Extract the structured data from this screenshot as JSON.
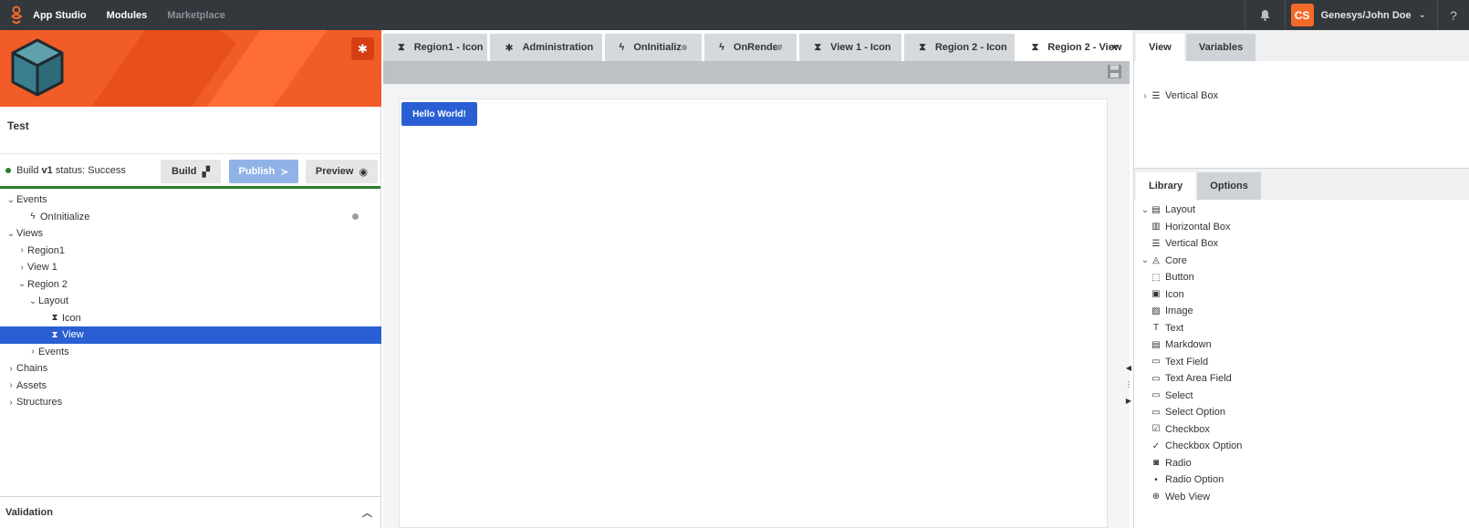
{
  "topbar": {
    "app_name": "App Studio",
    "modules": "Modules",
    "marketplace": "Marketplace",
    "avatar_initials": "CS",
    "user": "Genesys/John Doe",
    "help": "?"
  },
  "project": {
    "title": "Test",
    "build_prefix": "Build ",
    "build_version": "v1",
    "build_suffix": " status: Success",
    "build_btn": "Build",
    "publish_btn": "Publish",
    "preview_btn": "Preview"
  },
  "tree": [
    {
      "label": "Events",
      "level": 0,
      "arrow": "⌄",
      "icon": ""
    },
    {
      "label": "OnInitialize",
      "level": 1,
      "arrow": "",
      "icon": "ϟ",
      "dot": true
    },
    {
      "label": "Views",
      "level": 0,
      "arrow": "⌄",
      "icon": ""
    },
    {
      "label": "Region1",
      "level": 1,
      "arrow": "›",
      "icon": ""
    },
    {
      "label": "View 1",
      "level": 1,
      "arrow": "›",
      "icon": ""
    },
    {
      "label": "Region 2",
      "level": 1,
      "arrow": "⌄",
      "icon": ""
    },
    {
      "label": "Layout",
      "level": 2,
      "arrow": "⌄",
      "icon": ""
    },
    {
      "label": "Icon",
      "level": 3,
      "arrow": "",
      "icon": "⧗"
    },
    {
      "label": "View",
      "level": 3,
      "arrow": "",
      "icon": "⧗",
      "selected": true
    },
    {
      "label": "Events",
      "level": 2,
      "arrow": "›",
      "icon": ""
    },
    {
      "label": "Chains",
      "level": 0,
      "arrow": "›",
      "icon": ""
    },
    {
      "label": "Assets",
      "level": 0,
      "arrow": "›",
      "icon": ""
    },
    {
      "label": "Structures",
      "level": 0,
      "arrow": "›",
      "icon": ""
    }
  ],
  "validation": "Validation",
  "tabs": [
    {
      "label": "Region1 - Icon",
      "icon": "⧗",
      "width": 129
    },
    {
      "label": "Administration",
      "icon": "✱",
      "width": 138
    },
    {
      "label": "OnInitialize",
      "icon": "ϟ",
      "width": 120,
      "dot": true
    },
    {
      "label": "OnRender",
      "icon": "ϟ",
      "width": 114,
      "dot": true
    },
    {
      "label": "View 1 - Icon",
      "icon": "⧗",
      "width": 126
    },
    {
      "label": "Region 2 - Icon",
      "icon": "⧗",
      "width": 136
    },
    {
      "label": "Region 2 - View",
      "icon": "⧗",
      "width": 136,
      "active": true,
      "close": "×"
    }
  ],
  "canvas": {
    "hello_button": "Hello World!"
  },
  "view_panel": {
    "tabs": [
      "View",
      "Variables"
    ],
    "tree": [
      {
        "label": "Vertical Box",
        "icon": "☰"
      }
    ]
  },
  "library_panel": {
    "tabs": [
      "Library",
      "Options"
    ],
    "items": [
      {
        "label": "Layout",
        "group": true,
        "icon": "▤"
      },
      {
        "label": "Horizontal Box",
        "icon": "▥"
      },
      {
        "label": "Vertical Box",
        "icon": "☰"
      },
      {
        "label": "Core",
        "group": true,
        "icon": "◬"
      },
      {
        "label": "Button",
        "icon": "⬚"
      },
      {
        "label": "Icon",
        "icon": "▣"
      },
      {
        "label": "Image",
        "icon": "▨"
      },
      {
        "label": "Text",
        "icon": "T"
      },
      {
        "label": "Markdown",
        "icon": "▤"
      },
      {
        "label": "Text Field",
        "icon": "▭"
      },
      {
        "label": "Text Area Field",
        "icon": "▭"
      },
      {
        "label": "Select",
        "icon": "▭"
      },
      {
        "label": "Select Option",
        "icon": "▭"
      },
      {
        "label": "Checkbox",
        "icon": "☑"
      },
      {
        "label": "Checkbox Option",
        "icon": "✓"
      },
      {
        "label": "Radio",
        "icon": "◙"
      },
      {
        "label": "Radio Option",
        "icon": "•"
      },
      {
        "label": "Web View",
        "icon": "⊕"
      }
    ]
  },
  "colors": {
    "brand": "#f25c26",
    "accent": "#2a5fd3",
    "topbar": "#33383d",
    "success": "#2e7d32"
  }
}
